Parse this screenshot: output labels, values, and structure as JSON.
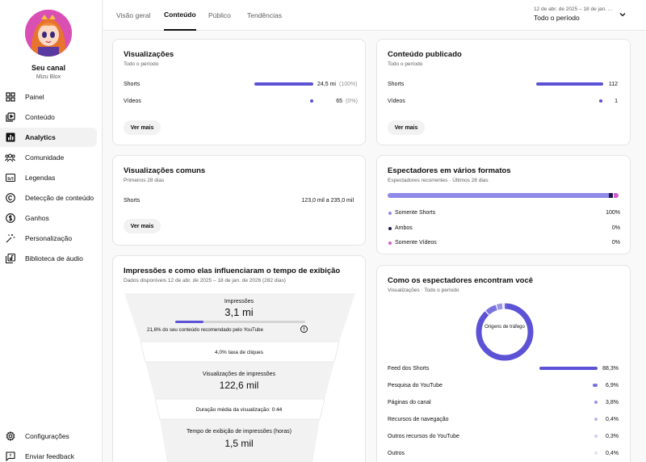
{
  "sidebar": {
    "channel_title": "Seu canal",
    "channel_name": "Mizu Blox",
    "items": [
      {
        "label": "Painel",
        "icon": "dashboard-icon"
      },
      {
        "label": "Conteúdo",
        "icon": "content-icon"
      },
      {
        "label": "Analytics",
        "icon": "analytics-icon"
      },
      {
        "label": "Comunidade",
        "icon": "community-icon"
      },
      {
        "label": "Legendas",
        "icon": "subtitles-icon"
      },
      {
        "label": "Detecção de conteúdo",
        "icon": "copyright-icon"
      },
      {
        "label": "Ganhos",
        "icon": "earn-icon"
      },
      {
        "label": "Personalização",
        "icon": "magic-wand-icon"
      },
      {
        "label": "Biblioteca de áudio",
        "icon": "audio-library-icon"
      }
    ],
    "bottom_items": [
      {
        "label": "Configurações",
        "icon": "gear-icon"
      },
      {
        "label": "Enviar feedback",
        "icon": "feedback-icon"
      }
    ]
  },
  "tabs": [
    {
      "label": "Visão geral"
    },
    {
      "label": "Conteúdo"
    },
    {
      "label": "Público"
    },
    {
      "label": "Tendências"
    }
  ],
  "date_filter": {
    "range": "12 de abr. de 2025 – 18 de jan. ...",
    "period": "Todo o período"
  },
  "views_card": {
    "title": "Visualizações",
    "subtitle": "Todo o período",
    "rows": [
      {
        "label": "Shorts",
        "value": "24,5 mi",
        "pct": "(100%)",
        "fraction": 1.0
      },
      {
        "label": "Vídeos",
        "value": "65",
        "pct": "(0%)",
        "fraction": 0.0
      }
    ],
    "button": "Ver mais"
  },
  "published_card": {
    "title": "Conteúdo publicado",
    "subtitle": "Todo o período",
    "rows": [
      {
        "label": "Shorts",
        "value": "112",
        "fraction": 1.0
      },
      {
        "label": "Vídeos",
        "value": "1",
        "fraction": 0.0
      }
    ],
    "button": "Ver mais"
  },
  "common_views_card": {
    "title": "Visualizações comuns",
    "subtitle": "Primeiros 28 dias",
    "row_label": "Shorts",
    "row_value": "123,0 mil a 235,0 mil",
    "button": "Ver mais"
  },
  "formats_card": {
    "title": "Espectadores em vários formatos",
    "subtitle": "Espectadores recorrentes · Últimos 28 dias",
    "items": [
      {
        "label": "Somente Shorts",
        "value": "100%",
        "color": "#8f8ae8"
      },
      {
        "label": "Ambos",
        "value": "0%",
        "color": "#1c1a4a"
      },
      {
        "label": "Somente Vídeos",
        "value": "0%",
        "color": "#d05ed1"
      }
    ]
  },
  "impressions_card": {
    "title": "Impressões e como elas influenciaram o tempo de exibição",
    "subtitle": "Dados disponíveis 12 de abr. de 2025 – 18 de jan. de 2026 (282 dias)",
    "impressions_label": "Impressões",
    "impressions_value": "3,1 mi",
    "recommended_text": "21,6% do seu conteúdo recomendado pelo YouTube",
    "recommended_fraction": 0.216,
    "ctr_text": "4,0% taxa de cliques",
    "views_label": "Visualizações de impressões",
    "views_value": "122,6 mil",
    "avg_duration_text": "Duração média da visualização: 0:44",
    "watch_label": "Tempo de exibição de impressões (horas)",
    "watch_value": "1,5 mil"
  },
  "traffic_card": {
    "title": "Como os espectadores encontram você",
    "subtitle": "Visualizações · Todo o período",
    "donut_label": "Origens de tráfego",
    "sources": [
      {
        "label": "Feed dos Shorts",
        "value": "88,3%",
        "fraction": 0.883,
        "color": "#5c52d6"
      },
      {
        "label": "Pesquisa do YouTube",
        "value": "6,9%",
        "fraction": 0.069,
        "color": "#7a72de"
      },
      {
        "label": "Páginas do canal",
        "value": "3,8%",
        "fraction": 0.038,
        "color": "#9a94e6"
      },
      {
        "label": "Recursos de navegação",
        "value": "0,4%",
        "fraction": 0.004,
        "color": "#bab6ee"
      },
      {
        "label": "Outros recursos do YouTube",
        "value": "0,3%",
        "fraction": 0.003,
        "color": "#d0cdf3"
      },
      {
        "label": "Outros",
        "value": "0,4%",
        "fraction": 0.004,
        "color": "#e2e0f7"
      }
    ]
  }
}
